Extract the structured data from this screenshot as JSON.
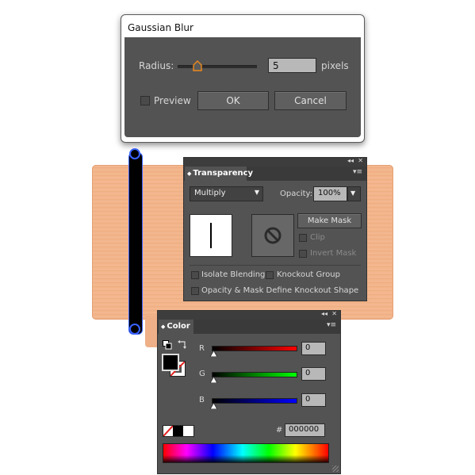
{
  "gaussian_blur": {
    "title": "Gaussian Blur",
    "radius_label": "Radius:",
    "radius_value": "5",
    "unit_label": "pixels",
    "preview_label": "Preview",
    "preview_checked": false,
    "ok_label": "OK",
    "cancel_label": "Cancel"
  },
  "transparency": {
    "tab_label": "Transparency",
    "blend_mode": "Multiply",
    "opacity_label": "Opacity:",
    "opacity_value": "100%",
    "make_mask_label": "Make Mask",
    "clip_label": "Clip",
    "invert_mask_label": "Invert Mask",
    "isolate_blending_label": "Isolate Blending",
    "knockout_group_label": "Knockout Group",
    "opacity_mask_label": "Opacity & Mask Define Knockout Shape"
  },
  "color": {
    "tab_label": "Color",
    "r_label": "R",
    "r_value": "0",
    "g_label": "G",
    "g_value": "0",
    "b_label": "B",
    "b_value": "0",
    "hex_label": "#",
    "hex_value": "000000",
    "fill_color": "#000000",
    "stroke": "none"
  },
  "panel_controls": {
    "collapse": "◂◂",
    "close": "✕",
    "menu": "▾≡"
  },
  "colors": {
    "panel_bg": "#535353",
    "selection_blue": "#3a63ff",
    "artwork_orange": "#f2b389"
  }
}
